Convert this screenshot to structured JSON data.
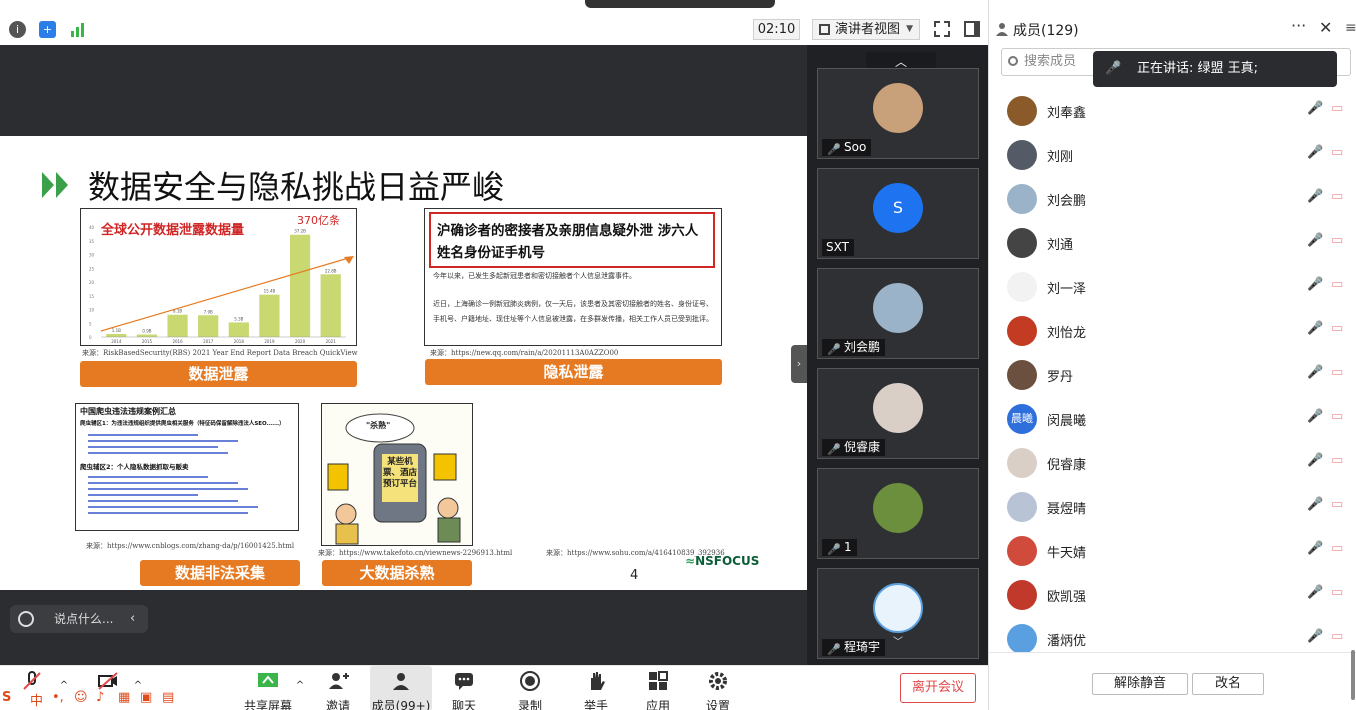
{
  "window": {
    "recording_banner": ""
  },
  "toolbar": {
    "icons": [
      "info-icon",
      "shield-icon",
      "signal-icon"
    ],
    "timer": "02:10",
    "view_mode": "演讲者视图",
    "icon_fullscreen": "fullscreen-icon",
    "icon_sidebar": "sidebar-icon"
  },
  "slide": {
    "title": "数据安全与隐私挑战日益严峻",
    "p1": {
      "chart_title": "全球公开数据泄露数据量",
      "highlight": "370亿条",
      "source": "来源：RiskBasedSecurity(RBS) 2021 Year End Report Data Breach QuickView",
      "button": "数据泄露"
    },
    "p2": {
      "headline": "沪确诊者的密接者及亲朋信息疑外泄 涉六人姓名身份证手机号",
      "line1": "今年以来，已发生多起新冠患者和密切接触者个人信息泄露事件。",
      "line2": "近日，上海确诊一例新冠肺炎病例，仅一天后，该患者及其密切接触者的姓名、身份证号、手机号、户籍地址、现住址等个人信息被泄露，在多群发传播，相关工作人员已受到批评。",
      "source": "来源：https://new.qq.com/rain/a/20201113A0AZZO00",
      "button": "隐私泄露"
    },
    "p3": {
      "heading": "中国爬虫违法违规案例汇总",
      "sub1": "爬虫辅区1：为违法违规组织提供爬虫相关服务（特征码保留解除违法人SEO......）",
      "sub2": "爬虫辅区2：个人隐私数据抓取与贩卖",
      "source": "来源：https://www.cnblogs.com/zhang-da/p/16001425.html",
      "button": "数据非法采集"
    },
    "p4": {
      "label_top": "\"杀熟\"",
      "phone_text": "某些机票、酒店预订平台",
      "source": "来源：https://www.takefoto.cn/viewnews-2296913.html",
      "button": "大数据杀熟"
    },
    "source_right": "来源：https://www.sohu.com/a/416410839_392936",
    "page_number": "4",
    "logo": "NSFOCUS"
  },
  "chart_data": {
    "type": "bar",
    "categories": [
      "2014",
      "2015",
      "2016",
      "2017",
      "2018",
      "2019",
      "2020",
      "2021"
    ],
    "values": [
      1.1,
      0.9,
      8.1,
      7.9,
      5.3,
      15.4,
      37.2,
      22.8
    ],
    "value_labels": [
      "1.1B",
      "0.9B",
      "8.1B",
      "7.9B",
      "5.3B",
      "15.4B",
      "37.2B",
      "22.8B"
    ],
    "ylim": [
      0,
      40
    ],
    "y_ticks": [
      0,
      5,
      10,
      15,
      20,
      25,
      30,
      35,
      40
    ],
    "title": "全球公开数据泄露数据量",
    "xlabel": "",
    "ylabel": "",
    "grid": false,
    "bar_color": "#c9d870",
    "trend_color": "#e77c25"
  },
  "chat": {
    "placeholder": "说点什么..."
  },
  "video_tiles": [
    {
      "name": "Soo",
      "avatar": "photo-avatar",
      "muted": true
    },
    {
      "name": "SXT",
      "avatar": "S",
      "muted": false
    },
    {
      "name": "刘会鹏",
      "avatar": "photo-avatar",
      "muted": true
    },
    {
      "name": "倪睿康",
      "avatar": "photo-avatar",
      "muted": true
    },
    {
      "name": "1",
      "avatar": "photo-avatar",
      "muted": true
    },
    {
      "name": "程琦宇",
      "avatar": "photo-avatar",
      "muted": true
    }
  ],
  "bottombar": {
    "share": "共享屏幕",
    "invite": "邀请",
    "members": "成员(99+)",
    "chat": "聊天",
    "record": "录制",
    "raise": "举手",
    "apps": "应用",
    "settings": "设置",
    "leave": "离开会议"
  },
  "ime": {
    "label": "中"
  },
  "panel": {
    "title": "成员(129)",
    "search_placeholder": "搜索成员",
    "speaking": "正在讲话: 绿盟 王真;",
    "members": [
      {
        "name": "刘奉鑫",
        "avatar_color": "#8b5a2b",
        "avatar_text": ""
      },
      {
        "name": "刘刚",
        "avatar_color": "#555b66",
        "avatar_text": ""
      },
      {
        "name": "刘会鹏",
        "avatar_color": "#9ab3c9",
        "avatar_text": ""
      },
      {
        "name": "刘通",
        "avatar_color": "#444444",
        "avatar_text": ""
      },
      {
        "name": "刘一泽",
        "avatar_color": "#f2f2f2",
        "avatar_text": ""
      },
      {
        "name": "刘怡龙",
        "avatar_color": "#c23b22",
        "avatar_text": ""
      },
      {
        "name": "罗丹",
        "avatar_color": "#6b4f3f",
        "avatar_text": ""
      },
      {
        "name": "闵晨曦",
        "avatar_color": "#2f6fdc",
        "avatar_text": "晨曦"
      },
      {
        "name": "倪睿康",
        "avatar_color": "#d9cfc7",
        "avatar_text": ""
      },
      {
        "name": "聂煜晴",
        "avatar_color": "#b8c4d6",
        "avatar_text": ""
      },
      {
        "name": "牛天婧",
        "avatar_color": "#d14b3c",
        "avatar_text": ""
      },
      {
        "name": "欧凯强",
        "avatar_color": "#c0392b",
        "avatar_text": ""
      },
      {
        "name": "潘炳优",
        "avatar_color": "#5aa0e0",
        "avatar_text": ""
      }
    ],
    "unmute_all": "解除静音",
    "rename": "改名"
  }
}
